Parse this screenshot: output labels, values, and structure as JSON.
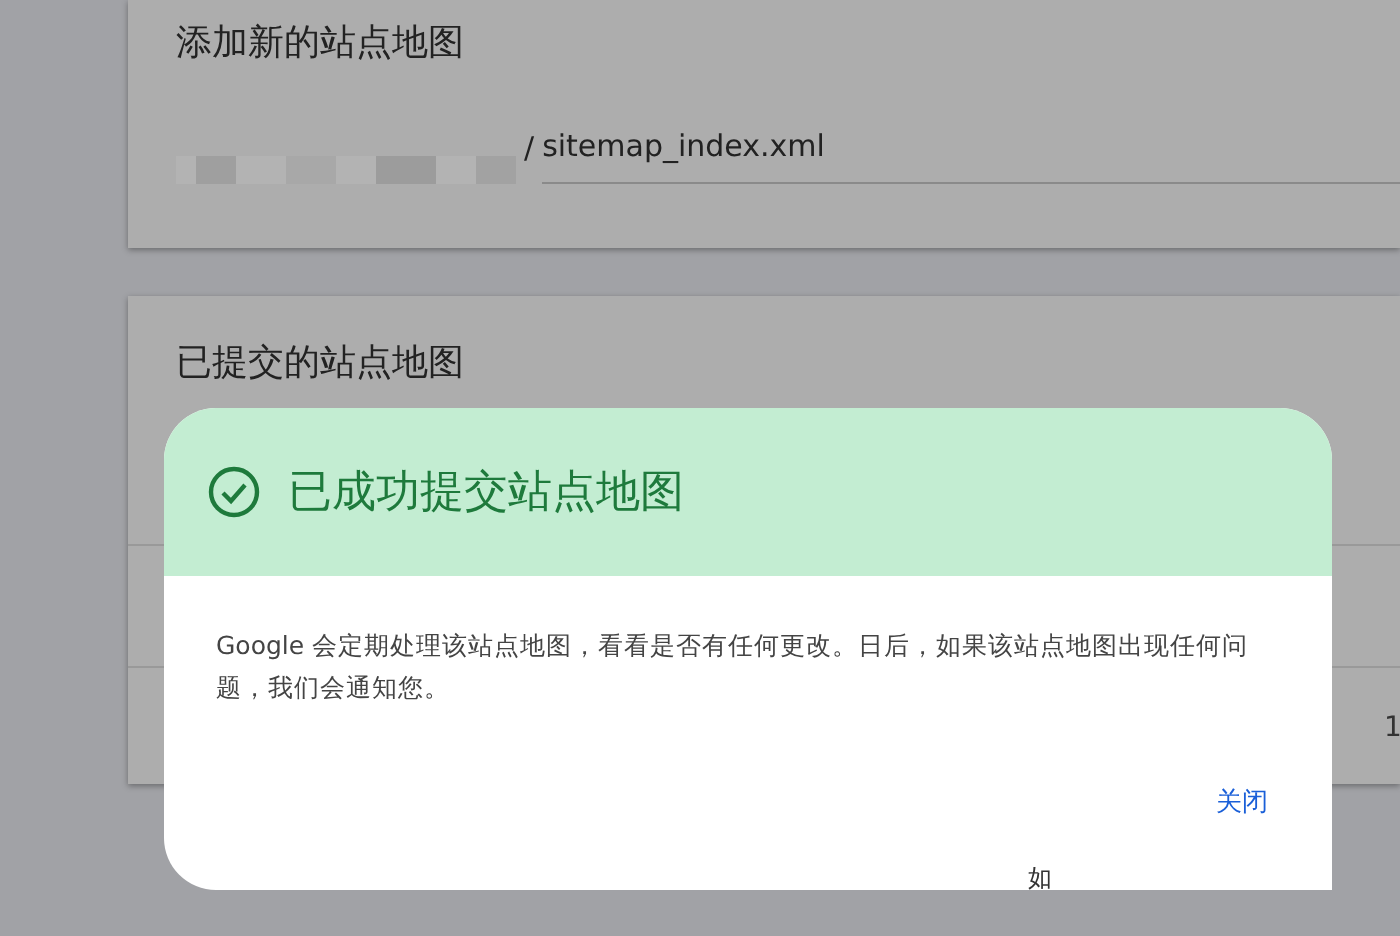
{
  "add_sitemap_card": {
    "title": "添加新的站点地图",
    "url_field": {
      "prefix": "/",
      "value": "sitemap_index.xml"
    }
  },
  "submitted_card": {
    "title": "已提交的站点地图",
    "cell_fragment": "1"
  },
  "dialog": {
    "title": "已成功提交站点地图",
    "message": "Google 会定期处理该站点地图，看看是否有任何更改。日后，如果该站点地图出现任何问题，我们会通知您。",
    "close_button": "关闭",
    "background_fragment": "如"
  }
}
